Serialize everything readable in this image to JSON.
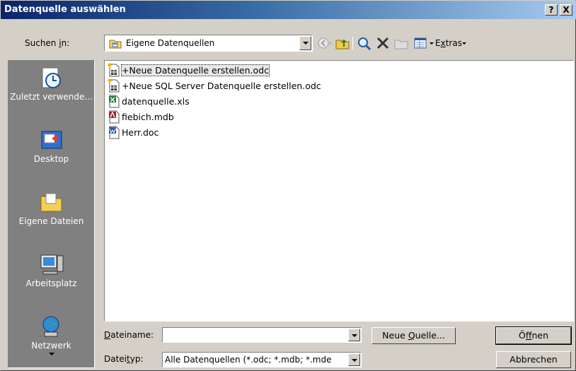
{
  "window": {
    "title": "Datenquelle auswählen",
    "help_label": "?",
    "close_label": "X"
  },
  "lookin": {
    "label_pre": "Suchen ",
    "label_ul": "i",
    "label_post": "n:",
    "value": "Eigene Datenquellen"
  },
  "toolbar": {
    "extras_pre": "E",
    "extras_ul": "x",
    "extras_post": "tras"
  },
  "places": [
    {
      "label": "Zuletzt verwende...",
      "icon": "recent-icon"
    },
    {
      "label": "Desktop",
      "icon": "desktop-icon"
    },
    {
      "label": "Eigene Dateien",
      "icon": "my-documents-icon"
    },
    {
      "label": "Arbeitsplatz",
      "icon": "my-computer-icon"
    },
    {
      "label": "Netzwerk",
      "icon": "network-icon"
    }
  ],
  "files": [
    {
      "name": "+Neue Datenquelle erstellen.odc",
      "icon": "odc-file-icon",
      "selected": true
    },
    {
      "name": "+Neue SQL Server Datenquelle erstellen.odc",
      "icon": "odc-file-icon"
    },
    {
      "name": "datenquelle.xls",
      "icon": "excel-file-icon"
    },
    {
      "name": "fiebich.mdb",
      "icon": "access-file-icon"
    },
    {
      "name": "Herr.doc",
      "icon": "word-file-icon"
    }
  ],
  "filename": {
    "label_ul": "D",
    "label_post": "ateiname:",
    "value": ""
  },
  "filetype": {
    "label_pre": "Datei",
    "label_ul": "t",
    "label_post": "yp:",
    "value": "Alle Datenquellen (*.odc; *.mdb; *.mde"
  },
  "buttons": {
    "new_source_pre": "Neue ",
    "new_source_ul": "Q",
    "new_source_post": "uelle...",
    "open_pre": "Ö",
    "open_ul": "f",
    "open_post": "fnen",
    "cancel": "Abbrechen"
  },
  "colors": {
    "title_gradient_start": "#0a246a",
    "title_gradient_end": "#a6caf0",
    "face": "#d4d0c8",
    "places_bar": "#808080"
  }
}
